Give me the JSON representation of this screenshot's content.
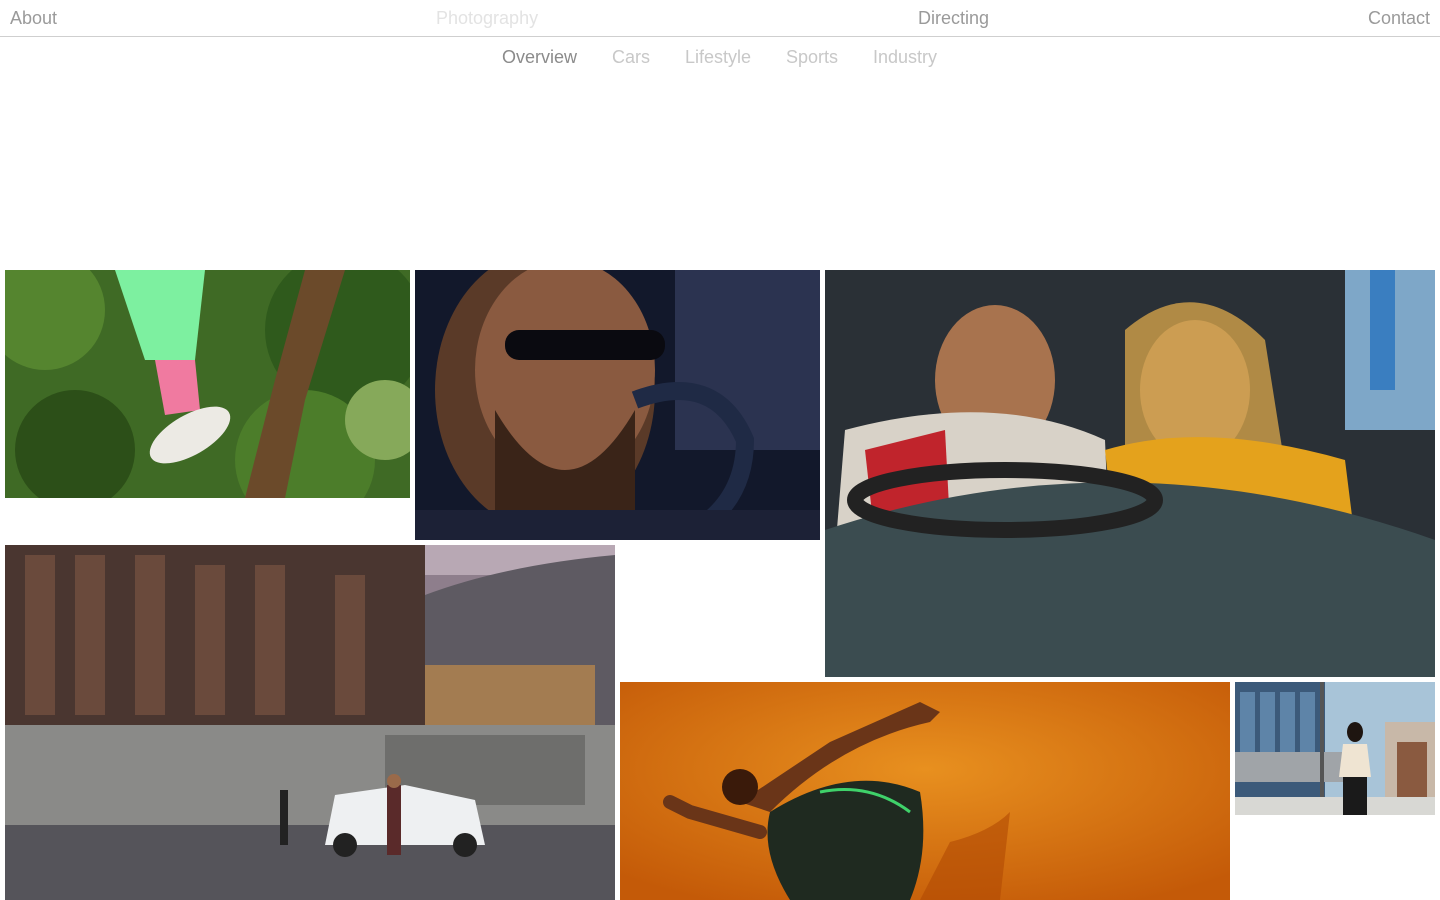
{
  "nav": {
    "about": "About",
    "photography": "Photography",
    "directing": "Directing",
    "contact": "Contact"
  },
  "subnav": [
    "Overview",
    "Cars",
    "Lifestyle",
    "Sports",
    "Industry"
  ],
  "colors": {
    "nav_text": "#9a9a9a",
    "nav_active": "#e3e3e3",
    "subnav_active": "#8b8b8b",
    "subnav_inactive": "#c8c8c8",
    "divider": "#cfcfcf"
  },
  "gallery": [
    {
      "subject": "legs-in-tree-photo"
    },
    {
      "subject": "bearded-driver-photo"
    },
    {
      "subject": "couple-in-car-photo"
    },
    {
      "subject": "modern-building-car-photo"
    },
    {
      "subject": "sprinter-orange-photo"
    },
    {
      "subject": "woman-city-street-photo"
    }
  ]
}
